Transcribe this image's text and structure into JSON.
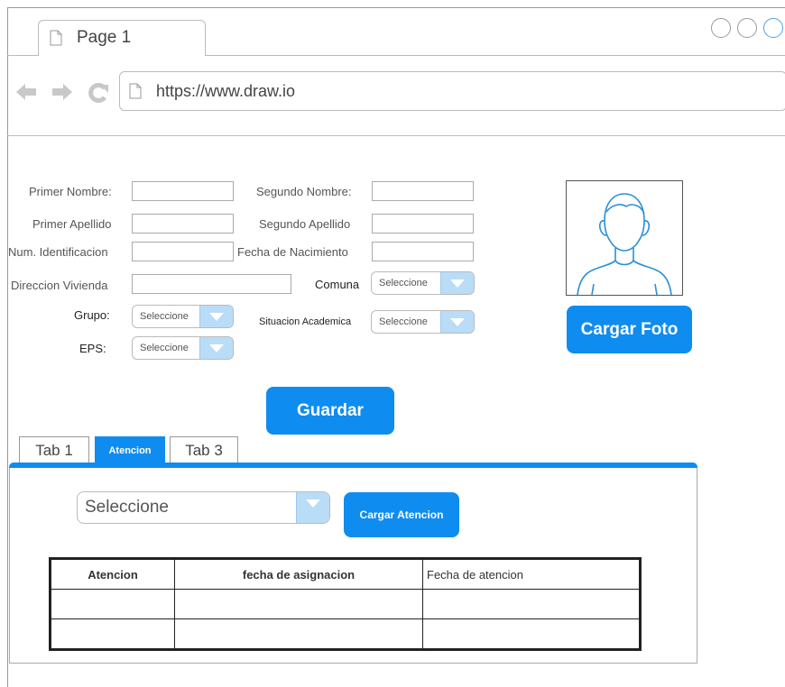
{
  "browser": {
    "tab_title": "Page 1",
    "url": "https://www.draw.io"
  },
  "form": {
    "primer_nombre_label": "Primer Nombre:",
    "segundo_nombre_label": "Segundo Nombre:",
    "primer_apellido_label": "Primer Apellido",
    "segundo_apellido_label": "Segundo Apellido",
    "num_identificacion_label": "Num. Identificacion",
    "fecha_nacimiento_label": "Fecha de Nacimiento",
    "direccion_label": "Direccion Vivienda",
    "comuna_label": "Comuna",
    "comuna_value": "Seleccione",
    "grupo_label": "Grupo:",
    "grupo_value": "Seleccione",
    "situacion_label": "Situacion Academica",
    "situacion_value": "Seleccione",
    "eps_label": "EPS:",
    "eps_value": "Seleccione",
    "cargar_foto": "Cargar Foto",
    "guardar": "Guardar"
  },
  "tabs": [
    {
      "label": "Tab 1"
    },
    {
      "label": "Atencion"
    },
    {
      "label": "Tab 3"
    }
  ],
  "atencion_panel": {
    "select_value": "Seleccione",
    "cargar_atencion": "Cargar Atencion",
    "table": {
      "headers": [
        "Atencion",
        "fecha de asignacion",
        "Fecha de atencion"
      ],
      "rows": [
        [
          "",
          "",
          ""
        ],
        [
          "",
          "",
          ""
        ]
      ]
    }
  },
  "colors": {
    "accent": "#0f8cf0",
    "dropdown_arrow": "#b9dcf7",
    "photo_outline": "#2a8fd8"
  }
}
